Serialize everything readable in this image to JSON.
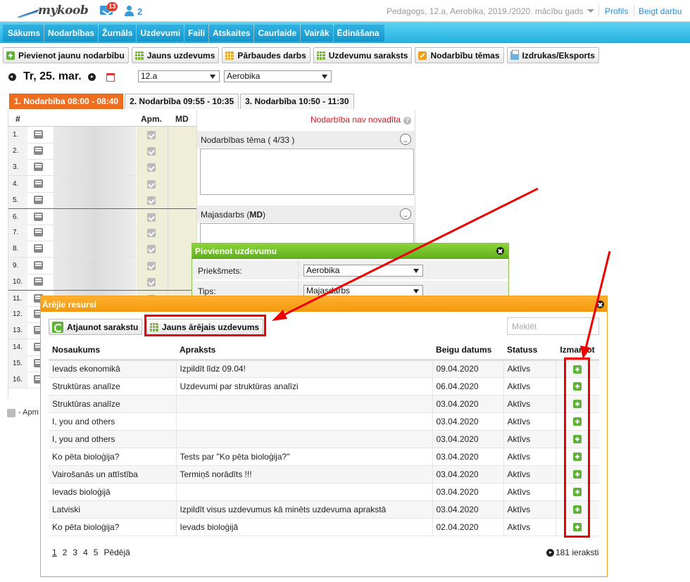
{
  "app": {
    "logo_text": "mykoob",
    "mail_count": "13",
    "user_count": "2"
  },
  "header": {
    "context": "Pedagogs, 12.a, Aerobika, 2019./2020. mācību gads",
    "profile": "Profils",
    "logout": "Beigt darbu"
  },
  "nav": [
    "Sākums",
    "Nodarbības",
    "Žurnāls",
    "Uzdevumi",
    "Faili",
    "Atskaites",
    "Caurlaide",
    "Vairāk",
    "Ēdināšana"
  ],
  "toolbar": {
    "add_lesson": "Pievienot jaunu nodarbību",
    "new_task": "Jauns uzdevums",
    "test": "Pārbaudes darbs",
    "task_list": "Uzdevumu saraksts",
    "lesson_topics": "Nodarbību tēmas",
    "export": "Izdrukas/Eksports"
  },
  "date": {
    "text": "Tr, 25. mar.",
    "class_value": "12.a",
    "subject_value": "Aerobika"
  },
  "tabs": [
    "1. Nodarbība 08:00 - 08:40",
    "2. Nodarbība 09:55 - 10:35",
    "3. Nodarbība 10:50 - 11:30"
  ],
  "grid": {
    "head_num": "#",
    "head_apm": "Apm.",
    "head_md": "MD",
    "rows": [
      "1.",
      "2.",
      "3.",
      "4.",
      "5.",
      "6.",
      "7.",
      "8.",
      "9.",
      "10.",
      "11.",
      "12.",
      "13.",
      "14.",
      "15.",
      "16."
    ],
    "legend": "- Apm"
  },
  "lesson": {
    "status": "Nodarbība nav novadīta",
    "help": "?",
    "topic_label": "Nodarbības tēma ( 4/33 )",
    "homework_label": "Majasdarbs",
    "homework_abbr": "MD"
  },
  "add_task_dialog": {
    "title": "Pievienot uzdevumu",
    "subject_label": "Priekšmets:",
    "subject_value": "Aerobika",
    "type_label": "Tips:",
    "type_value": "Majasdarbs"
  },
  "external_dialog": {
    "title": "Ārējie resursi",
    "refresh": "Atjaunot sarakstu",
    "new_external": "Jauns ārējais uzdevums",
    "search_placeholder": "Meklēt",
    "columns": [
      "Nosaukums",
      "Apraksts",
      "Beigu datums",
      "Statuss",
      "Izmantot"
    ],
    "rows": [
      {
        "name": "Ievads ekonomikā",
        "desc": "Izpildīt līdz 09.04!",
        "date": "09.04.2020",
        "status": "Aktīvs"
      },
      {
        "name": "Struktūras analīze",
        "desc": "Uzdevumi par struktūras analīzi",
        "date": "06.04.2020",
        "status": "Aktīvs"
      },
      {
        "name": "Struktūras analīze",
        "desc": "",
        "date": "03.04.2020",
        "status": "Aktīvs"
      },
      {
        "name": "I, you and others",
        "desc": "",
        "date": "03.04.2020",
        "status": "Aktīvs"
      },
      {
        "name": "I, you and others",
        "desc": "",
        "date": "03.04.2020",
        "status": "Aktīvs"
      },
      {
        "name": "Ko pēta bioloģija?",
        "desc": "Tests par \"Ko pēta bioloģija?\"",
        "date": "03.04.2020",
        "status": "Aktīvs"
      },
      {
        "name": "Vairošanās un attīstība",
        "desc": "Termiņš norādīts !!!",
        "date": "03.04.2020",
        "status": "Aktīvs"
      },
      {
        "name": "Ievads bioloģijā",
        "desc": "",
        "date": "03.04.2020",
        "status": "Aktīvs"
      },
      {
        "name": "Latviski",
        "desc": "Izpildīt visus uzdevumus kā minēts uzdevuma aprakstā",
        "date": "03.04.2020",
        "status": "Aktīvs"
      },
      {
        "name": "Ko pēta bioloģija?",
        "desc": "Ievads bioloģijā",
        "date": "02.04.2020",
        "status": "Aktīvs"
      }
    ],
    "pages": [
      "1",
      "2",
      "3",
      "4",
      "5",
      "Pēdējā"
    ],
    "record_count": "181 ieraksti"
  },
  "colors": {
    "accent_blue": "#26b3e3",
    "tab_orange": "#ef6d1f",
    "green": "#5fb336",
    "dialog_orange": "#f29a0e",
    "annotation_red": "#e00000"
  }
}
